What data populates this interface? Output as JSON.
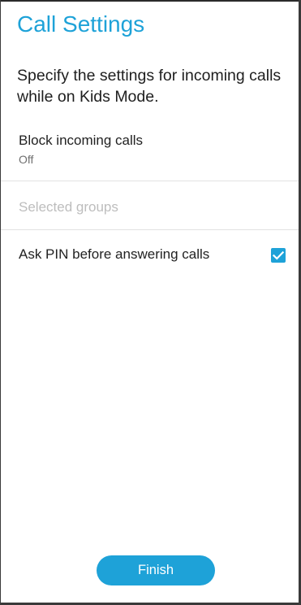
{
  "header": {
    "title": "Call Settings"
  },
  "description": "Specify the settings for incoming calls while on Kids Mode.",
  "settings": {
    "block_incoming": {
      "label": "Block incoming calls",
      "value": "Off"
    },
    "selected_groups": {
      "label": "Selected groups",
      "enabled": false
    },
    "ask_pin": {
      "label": "Ask PIN before answering calls",
      "checked": true
    }
  },
  "footer": {
    "finish_label": "Finish"
  },
  "colors": {
    "accent": "#1ea2d8",
    "text_primary": "#222222",
    "text_secondary": "#6f6f6f",
    "text_disabled": "#bdbdbd",
    "divider": "#e2e2e2"
  },
  "icons": {
    "checkbox": "checkmark-icon"
  }
}
